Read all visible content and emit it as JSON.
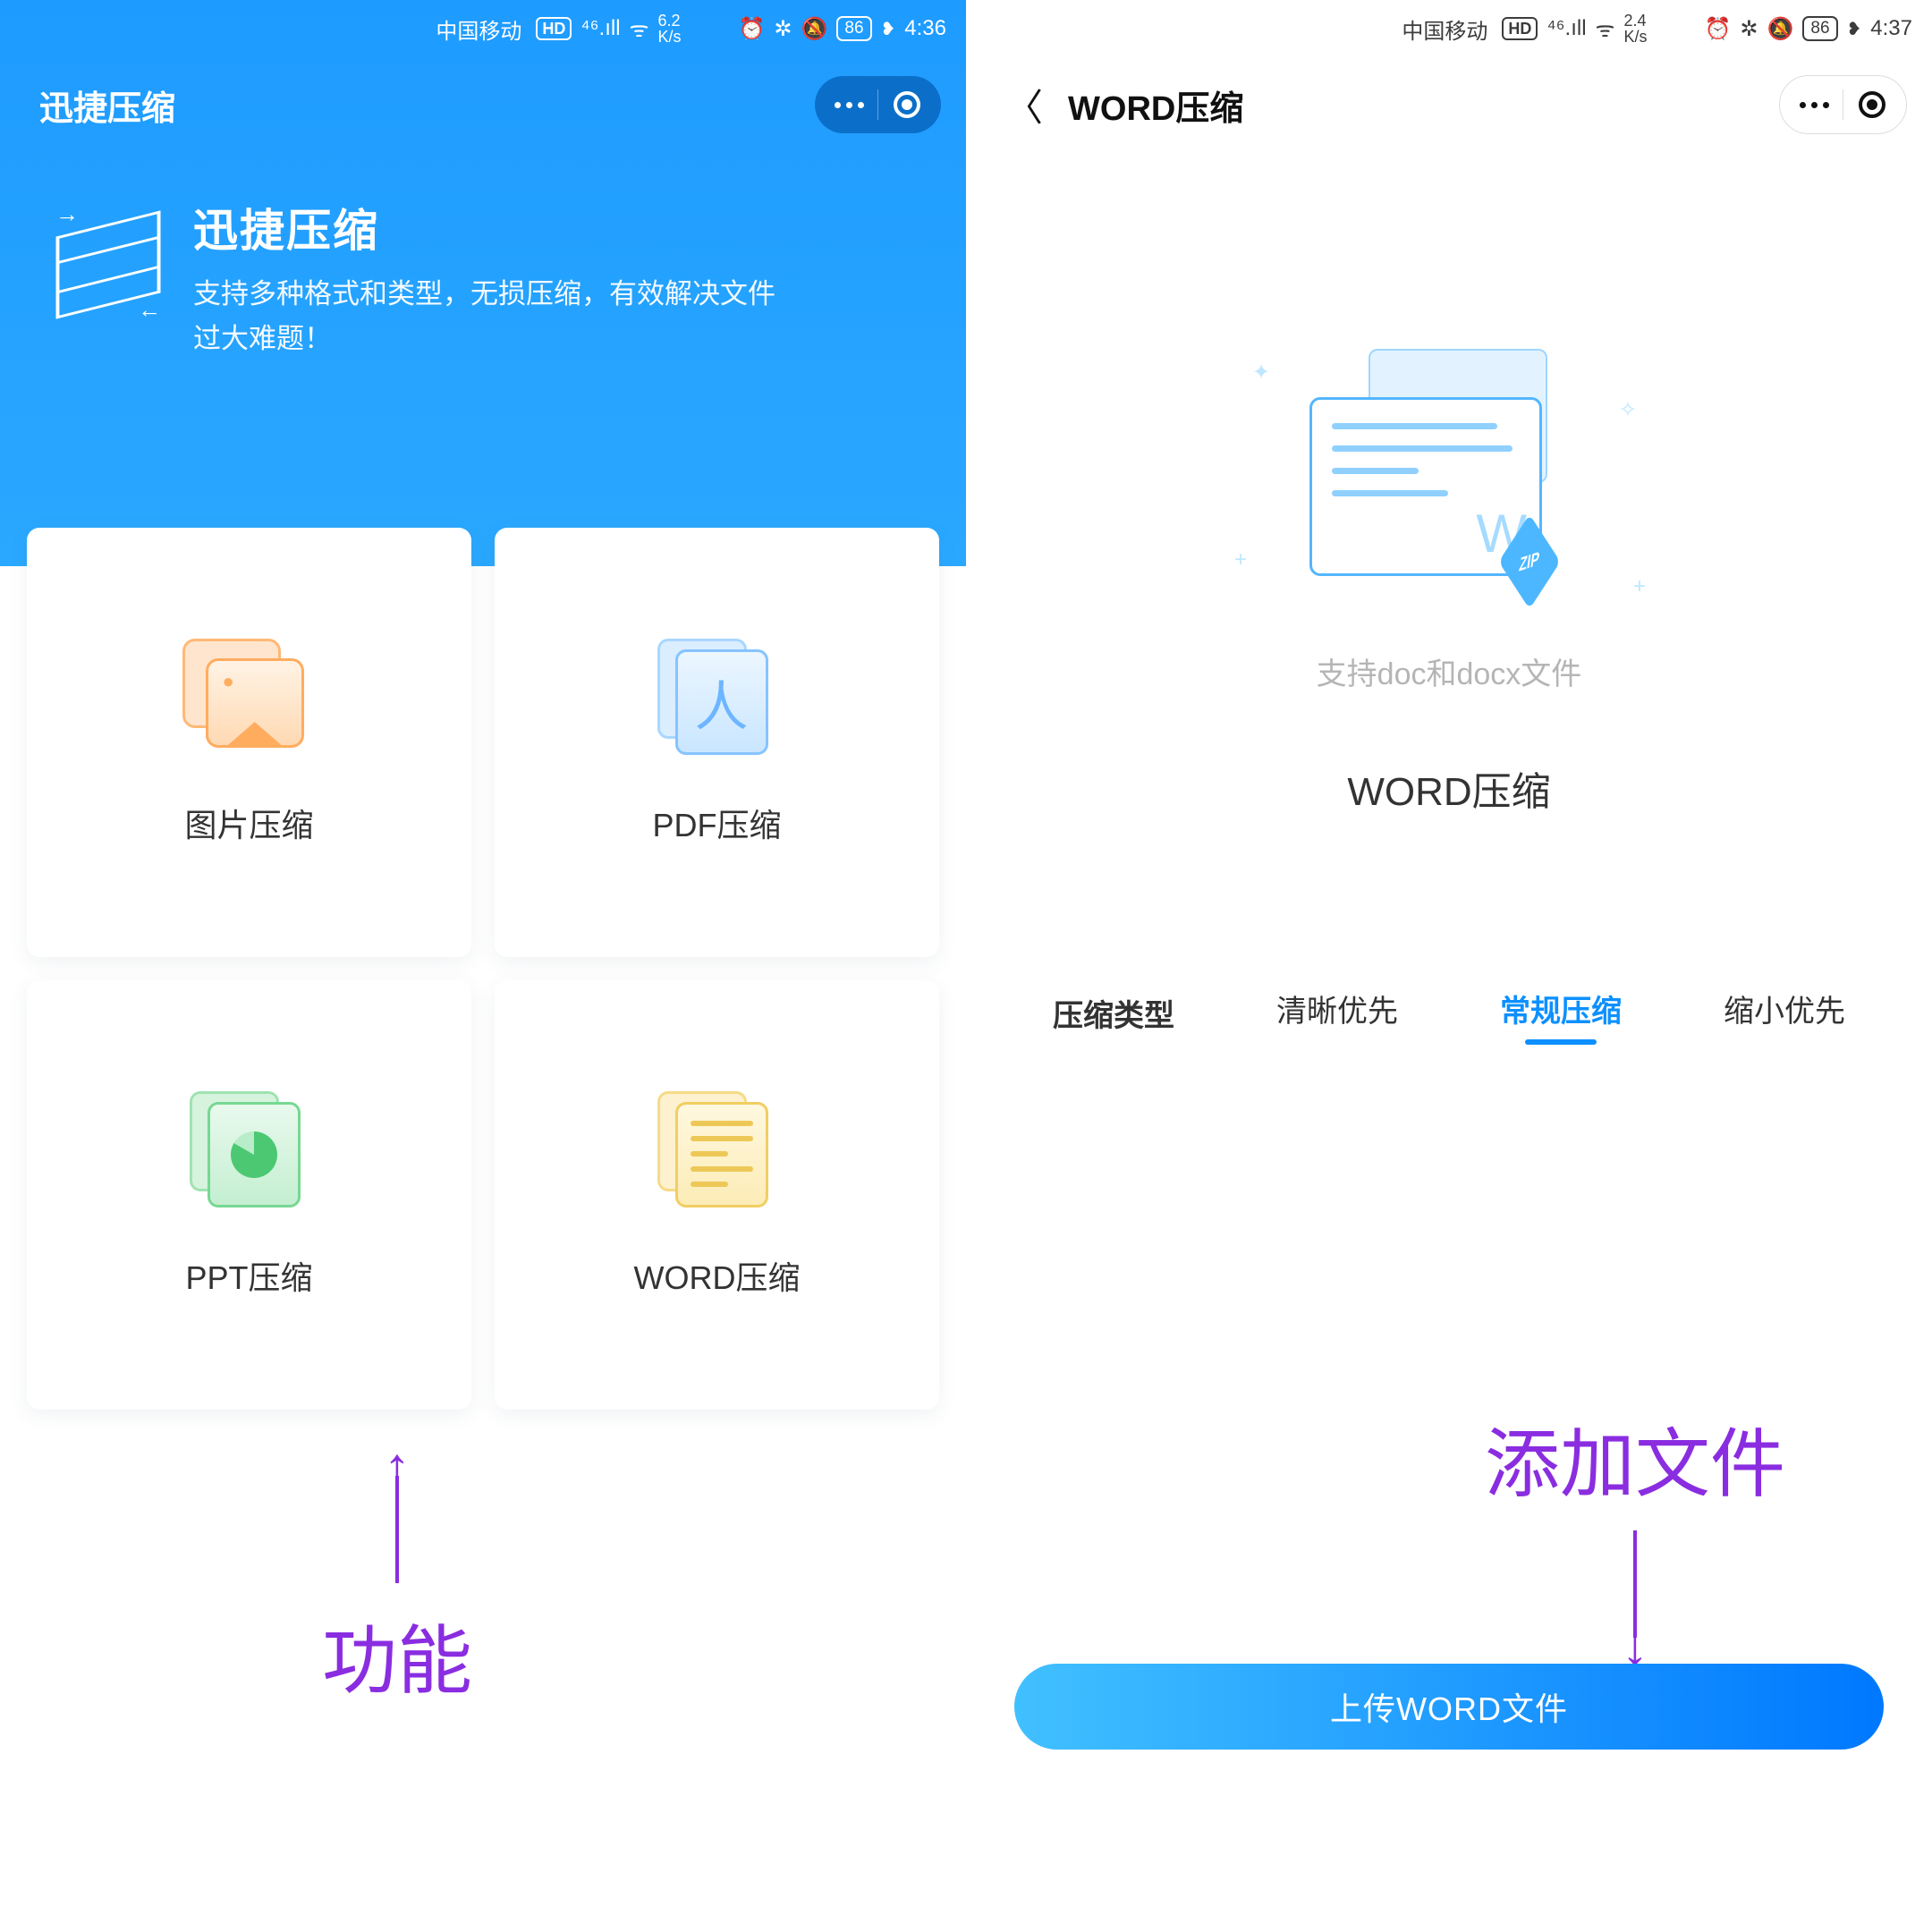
{
  "left": {
    "status": {
      "carrier": "中国移动",
      "hd": "HD",
      "net": "⁴⁶.ıll",
      "wifi": "ᯤ",
      "speed_num": "6.2",
      "speed_unit": "K/s",
      "alarm": "⏰",
      "bt": "✲",
      "mute": "🔕",
      "battery": "86",
      "time": "4:36"
    },
    "title": "迅捷压缩",
    "hero_title": "迅捷压缩",
    "hero_sub": "支持多种格式和类型，无损压缩，有效解决文件过大难题！",
    "cards": {
      "image": "图片压缩",
      "pdf": "PDF压缩",
      "ppt": "PPT压缩",
      "word": "WORD压缩"
    },
    "anno": "功能"
  },
  "right": {
    "status": {
      "carrier": "中国移动",
      "hd": "HD",
      "net": "⁴⁶.ıll",
      "wifi": "ᯤ",
      "speed_num": "2.4",
      "speed_unit": "K/s",
      "alarm": "⏰",
      "bt": "✲",
      "mute": "🔕",
      "battery": "86",
      "time": "4:37"
    },
    "title": "WORD压缩",
    "support": "支持doc和docx文件",
    "h2": "WORD压缩",
    "zip": "ZIP",
    "w": "W",
    "opts_label": "压缩类型",
    "opts": {
      "clarity": "清晰优先",
      "normal": "常规压缩",
      "smallest": "缩小优先"
    },
    "upload": "上传WORD文件",
    "anno": "添加文件"
  },
  "arrows": {
    "up": "↑",
    "down": "↓"
  }
}
